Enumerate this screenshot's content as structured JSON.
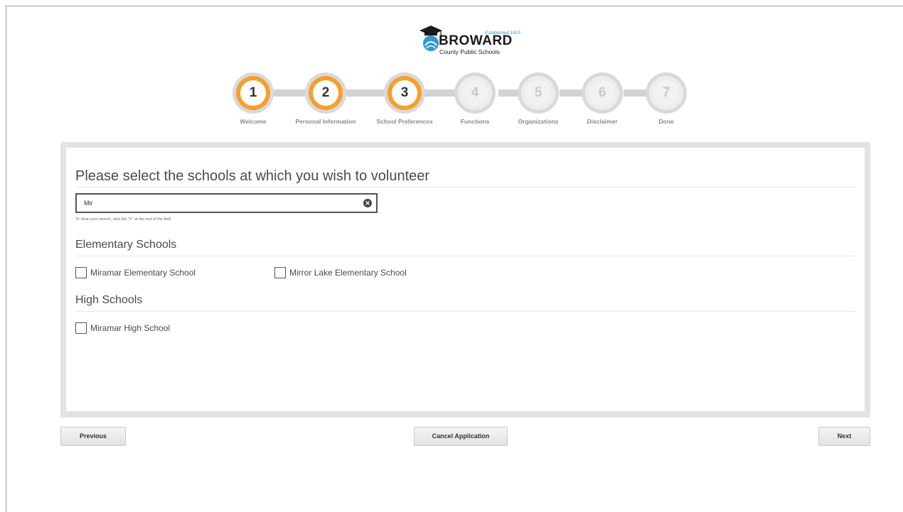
{
  "header": {
    "logo": {
      "established": "Established 1915",
      "name": "BROWARD",
      "subtitle": "County Public Schools"
    }
  },
  "stepper": {
    "steps": [
      {
        "number": "1",
        "label": "Welcome",
        "active": true
      },
      {
        "number": "2",
        "label": "Personal Information",
        "active": true
      },
      {
        "number": "3",
        "label": "School Preferences",
        "active": true
      },
      {
        "number": "4",
        "label": "Functions",
        "active": false
      },
      {
        "number": "5",
        "label": "Organizations",
        "active": false
      },
      {
        "number": "6",
        "label": "Disclaimer",
        "active": false
      },
      {
        "number": "7",
        "label": "Done",
        "active": false
      }
    ],
    "active_color": "#f5a02c"
  },
  "form": {
    "title": "Please select the schools at which you wish to volunteer",
    "search": {
      "value": "Mir",
      "clear_icon": "close-circle-icon"
    },
    "hint": "To clear your search, click the \"X\" at the end of the field",
    "sections": [
      {
        "title": "Elementary Schools",
        "schools": [
          {
            "label": "Miramar Elementary School",
            "checked": false
          },
          {
            "label": "Mirror Lake Elementary School",
            "checked": false
          }
        ]
      },
      {
        "title": "High Schools",
        "schools": [
          {
            "label": "Miramar High School",
            "checked": false
          }
        ]
      }
    ]
  },
  "footer": {
    "previous_label": "Previous",
    "cancel_label": "Cancel Application",
    "next_label": "Next"
  }
}
